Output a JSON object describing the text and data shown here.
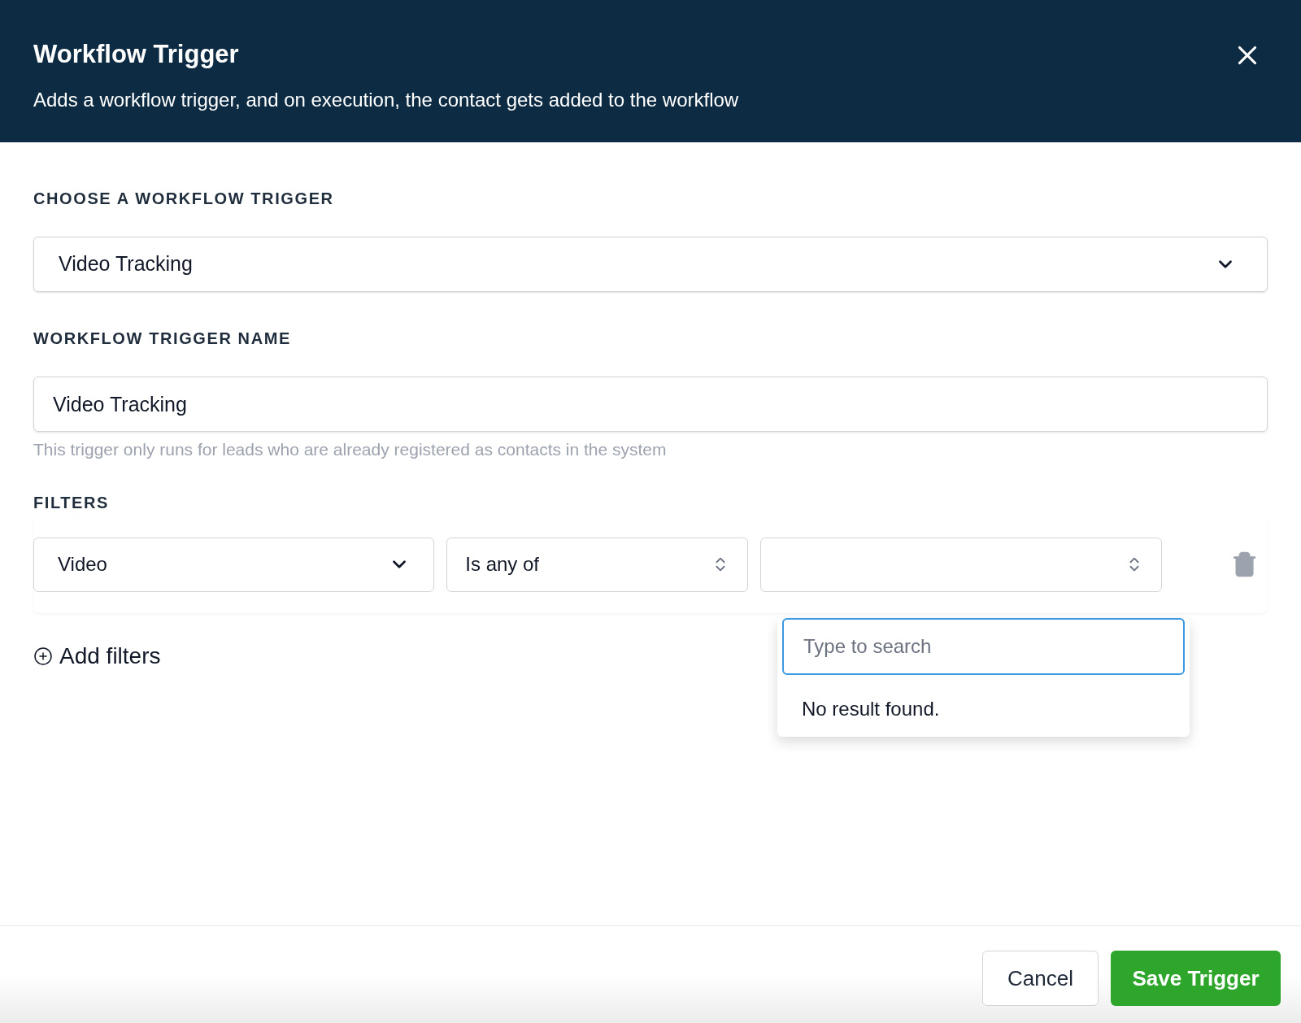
{
  "modal": {
    "title": "Workflow Trigger",
    "subtitle": "Adds a workflow trigger, and on execution, the contact gets added to the workflow"
  },
  "trigger_section": {
    "label": "CHOOSE A WORKFLOW TRIGGER",
    "select": {
      "value": "Video Tracking"
    }
  },
  "name_section": {
    "label": "WORKFLOW TRIGGER NAME",
    "input": {
      "value": "Video Tracking"
    },
    "hint": "This trigger only runs for leads who are already registered as contacts in the system"
  },
  "filters": {
    "label": "FILTERS",
    "rows": [
      {
        "field": {
          "value": "Video"
        },
        "operator": {
          "value": "Is any of"
        },
        "values_dropdown": {
          "expanded": true,
          "search_placeholder": "Type to search",
          "empty_message": "No result found."
        }
      }
    ],
    "add_button": "Add filters"
  },
  "footer": {
    "buttons": [
      {
        "label": "Cancel",
        "kind": "secondary"
      },
      {
        "label": "Save Trigger",
        "kind": "primary"
      }
    ]
  }
}
